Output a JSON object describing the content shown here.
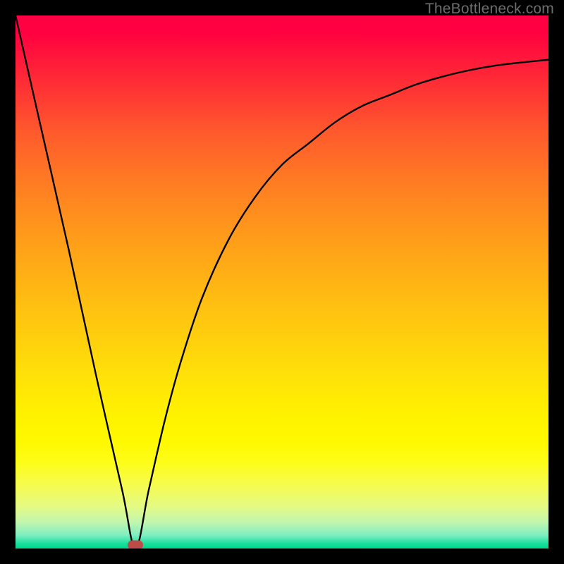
{
  "watermark": "TheBottleneck.com",
  "marker": {
    "x_pct": 22.5,
    "y_pct": 99.3
  },
  "chart_data": {
    "type": "line",
    "title": "",
    "xlabel": "",
    "ylabel": "",
    "xlim": [
      0,
      100
    ],
    "ylim": [
      0,
      100
    ],
    "grid": false,
    "legend": false,
    "series": [
      {
        "name": "bottleneck-curve",
        "x": [
          0,
          5,
          10,
          15,
          20,
          22.5,
          25,
          28,
          31,
          35,
          40,
          45,
          50,
          55,
          60,
          65,
          70,
          75,
          80,
          85,
          90,
          95,
          100
        ],
        "y": [
          100,
          78,
          56,
          33,
          11,
          0,
          11,
          24,
          35,
          47,
          58,
          66,
          72,
          76,
          80,
          83,
          85,
          87,
          88.5,
          89.7,
          90.6,
          91.2,
          91.7
        ]
      }
    ],
    "annotations": [
      {
        "type": "marker",
        "x": 22.5,
        "y": 0,
        "label": "optimal-point"
      }
    ],
    "background_gradient": {
      "orientation": "vertical",
      "stops": [
        {
          "pos": 0.0,
          "color": "#ff0044"
        },
        {
          "pos": 0.5,
          "color": "#ffb014"
        },
        {
          "pos": 0.8,
          "color": "#fff900"
        },
        {
          "pos": 1.0,
          "color": "#00d68f"
        }
      ]
    }
  }
}
